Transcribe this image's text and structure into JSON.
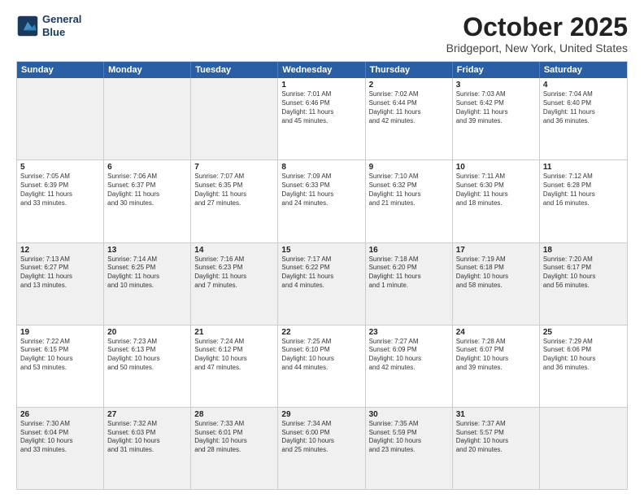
{
  "header": {
    "logo_line1": "General",
    "logo_line2": "Blue",
    "month": "October 2025",
    "location": "Bridgeport, New York, United States"
  },
  "weekdays": [
    "Sunday",
    "Monday",
    "Tuesday",
    "Wednesday",
    "Thursday",
    "Friday",
    "Saturday"
  ],
  "rows": [
    [
      {
        "day": "",
        "info": "",
        "shaded": true
      },
      {
        "day": "",
        "info": "",
        "shaded": true
      },
      {
        "day": "",
        "info": "",
        "shaded": true
      },
      {
        "day": "1",
        "info": "Sunrise: 7:01 AM\nSunset: 6:46 PM\nDaylight: 11 hours\nand 45 minutes."
      },
      {
        "day": "2",
        "info": "Sunrise: 7:02 AM\nSunset: 6:44 PM\nDaylight: 11 hours\nand 42 minutes."
      },
      {
        "day": "3",
        "info": "Sunrise: 7:03 AM\nSunset: 6:42 PM\nDaylight: 11 hours\nand 39 minutes."
      },
      {
        "day": "4",
        "info": "Sunrise: 7:04 AM\nSunset: 6:40 PM\nDaylight: 11 hours\nand 36 minutes."
      }
    ],
    [
      {
        "day": "5",
        "info": "Sunrise: 7:05 AM\nSunset: 6:39 PM\nDaylight: 11 hours\nand 33 minutes."
      },
      {
        "day": "6",
        "info": "Sunrise: 7:06 AM\nSunset: 6:37 PM\nDaylight: 11 hours\nand 30 minutes."
      },
      {
        "day": "7",
        "info": "Sunrise: 7:07 AM\nSunset: 6:35 PM\nDaylight: 11 hours\nand 27 minutes."
      },
      {
        "day": "8",
        "info": "Sunrise: 7:09 AM\nSunset: 6:33 PM\nDaylight: 11 hours\nand 24 minutes."
      },
      {
        "day": "9",
        "info": "Sunrise: 7:10 AM\nSunset: 6:32 PM\nDaylight: 11 hours\nand 21 minutes."
      },
      {
        "day": "10",
        "info": "Sunrise: 7:11 AM\nSunset: 6:30 PM\nDaylight: 11 hours\nand 18 minutes."
      },
      {
        "day": "11",
        "info": "Sunrise: 7:12 AM\nSunset: 6:28 PM\nDaylight: 11 hours\nand 16 minutes."
      }
    ],
    [
      {
        "day": "12",
        "info": "Sunrise: 7:13 AM\nSunset: 6:27 PM\nDaylight: 11 hours\nand 13 minutes.",
        "shaded": true
      },
      {
        "day": "13",
        "info": "Sunrise: 7:14 AM\nSunset: 6:25 PM\nDaylight: 11 hours\nand 10 minutes.",
        "shaded": true
      },
      {
        "day": "14",
        "info": "Sunrise: 7:16 AM\nSunset: 6:23 PM\nDaylight: 11 hours\nand 7 minutes.",
        "shaded": true
      },
      {
        "day": "15",
        "info": "Sunrise: 7:17 AM\nSunset: 6:22 PM\nDaylight: 11 hours\nand 4 minutes.",
        "shaded": true
      },
      {
        "day": "16",
        "info": "Sunrise: 7:18 AM\nSunset: 6:20 PM\nDaylight: 11 hours\nand 1 minute.",
        "shaded": true
      },
      {
        "day": "17",
        "info": "Sunrise: 7:19 AM\nSunset: 6:18 PM\nDaylight: 10 hours\nand 58 minutes.",
        "shaded": true
      },
      {
        "day": "18",
        "info": "Sunrise: 7:20 AM\nSunset: 6:17 PM\nDaylight: 10 hours\nand 56 minutes.",
        "shaded": true
      }
    ],
    [
      {
        "day": "19",
        "info": "Sunrise: 7:22 AM\nSunset: 6:15 PM\nDaylight: 10 hours\nand 53 minutes."
      },
      {
        "day": "20",
        "info": "Sunrise: 7:23 AM\nSunset: 6:13 PM\nDaylight: 10 hours\nand 50 minutes."
      },
      {
        "day": "21",
        "info": "Sunrise: 7:24 AM\nSunset: 6:12 PM\nDaylight: 10 hours\nand 47 minutes."
      },
      {
        "day": "22",
        "info": "Sunrise: 7:25 AM\nSunset: 6:10 PM\nDaylight: 10 hours\nand 44 minutes."
      },
      {
        "day": "23",
        "info": "Sunrise: 7:27 AM\nSunset: 6:09 PM\nDaylight: 10 hours\nand 42 minutes."
      },
      {
        "day": "24",
        "info": "Sunrise: 7:28 AM\nSunset: 6:07 PM\nDaylight: 10 hours\nand 39 minutes."
      },
      {
        "day": "25",
        "info": "Sunrise: 7:29 AM\nSunset: 6:06 PM\nDaylight: 10 hours\nand 36 minutes."
      }
    ],
    [
      {
        "day": "26",
        "info": "Sunrise: 7:30 AM\nSunset: 6:04 PM\nDaylight: 10 hours\nand 33 minutes.",
        "shaded": true
      },
      {
        "day": "27",
        "info": "Sunrise: 7:32 AM\nSunset: 6:03 PM\nDaylight: 10 hours\nand 31 minutes.",
        "shaded": true
      },
      {
        "day": "28",
        "info": "Sunrise: 7:33 AM\nSunset: 6:01 PM\nDaylight: 10 hours\nand 28 minutes.",
        "shaded": true
      },
      {
        "day": "29",
        "info": "Sunrise: 7:34 AM\nSunset: 6:00 PM\nDaylight: 10 hours\nand 25 minutes.",
        "shaded": true
      },
      {
        "day": "30",
        "info": "Sunrise: 7:35 AM\nSunset: 5:59 PM\nDaylight: 10 hours\nand 23 minutes.",
        "shaded": true
      },
      {
        "day": "31",
        "info": "Sunrise: 7:37 AM\nSunset: 5:57 PM\nDaylight: 10 hours\nand 20 minutes.",
        "shaded": true
      },
      {
        "day": "",
        "info": "",
        "shaded": true
      }
    ]
  ]
}
